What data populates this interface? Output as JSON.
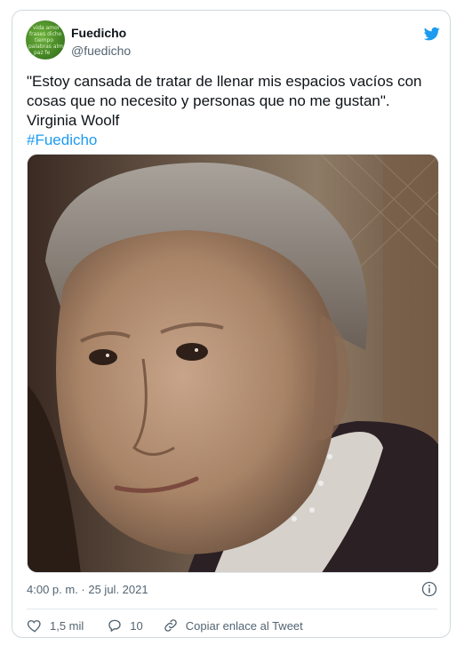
{
  "tweet": {
    "author_name": "Fuedicho",
    "author_handle": "@fuedicho",
    "text_lines": [
      "\"Estoy cansada de tratar de llenar mis espacios vacíos con",
      "cosas que no necesito y personas que no me gustan\".",
      "Virginia Woolf"
    ],
    "hashtag": "#Fuedicho",
    "timestamp": "4:00 p. m. · 25 jul. 2021",
    "likes_count": "1,5 mil",
    "replies_count": "10",
    "copy_link_label": "Copiar enlace al Tweet"
  },
  "colors": {
    "accent": "#1d9bf0",
    "secondary_text": "#536471",
    "border": "#cfd9de"
  },
  "icons": {
    "brand": "twitter-bird-icon",
    "info": "info-icon",
    "like": "heart-icon",
    "reply": "reply-bubble-icon",
    "copy_link": "link-icon"
  }
}
